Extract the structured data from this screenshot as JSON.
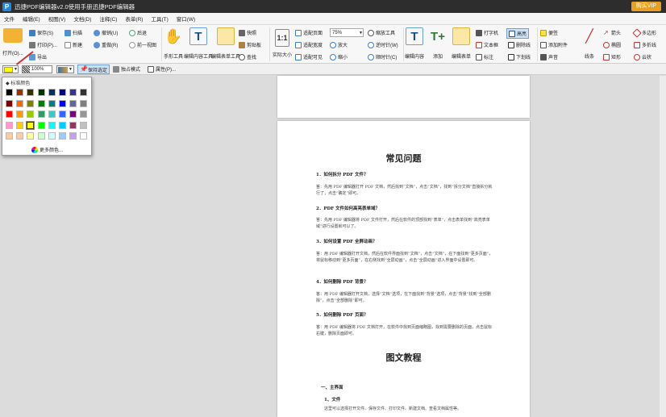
{
  "title": "迅捷PDF编辑器v2.0使用手册迅捷PDF编辑器",
  "vip_button": "购买VIP",
  "menu": [
    "文件",
    "编辑(E)",
    "视图(V)",
    "文档(D)",
    "注释(C)",
    "表单(R)",
    "工具(T)",
    "窗口(W)"
  ],
  "ribbon": {
    "open": "打开(O)...",
    "save": "保存(S)",
    "print": "打印(P)...",
    "export": "导出",
    "scan": "扫描",
    "new": "新建",
    "undo": "撤销(U)",
    "redo": "重做(R)",
    "prev_view": "后退",
    "next_view": "前一视图",
    "hand_tool": "手形工具",
    "edit_content_tool": "编辑内容工具",
    "edit_form_tool": "编辑表单工具",
    "snapshot": "快照",
    "clipboard": "剪贴板",
    "find": "查找",
    "actual_size": "实际大小",
    "fit_page": "适配页面",
    "fit_width": "适配宽度",
    "fit_visible": "适配可见",
    "zoom_value": "75%",
    "zoom_in": "放大",
    "zoom_out": "缩小",
    "zoom_tool": "缩放工具",
    "rotate_left": "逆时针(W)",
    "rotate_right": "顺时针(C)",
    "edit_content": "编辑内容",
    "add": "添加",
    "edit_form": "编辑表单",
    "typewriter": "打字机",
    "text_box": "文本框",
    "callout": "标注",
    "highlight": "高亮",
    "strikeout": "删除线",
    "underline": "下划线",
    "note": "便签",
    "attach_file": "添加附件",
    "sound": "声音",
    "line": "线条",
    "arrow": "箭头",
    "oval": "椭圆",
    "rectangle": "矩形",
    "polygon": "多边形",
    "polyline": "多折线",
    "cloud": "云状"
  },
  "toolbar2": {
    "opacity": "100%",
    "keep_tool_selected": "保持选定",
    "exclusive_mode": "独占模式",
    "properties": "属性(P)..."
  },
  "palette": {
    "header": "标准颜色",
    "more_colors": "更多颜色...",
    "selected": "#ffff00",
    "colors": [
      [
        "#000000",
        "#993300",
        "#333300",
        "#003300",
        "#003366",
        "#000080",
        "#333399",
        "#333333"
      ],
      [
        "#800000",
        "#ff6600",
        "#808000",
        "#008000",
        "#008080",
        "#0000ff",
        "#666699",
        "#808080"
      ],
      [
        "#ff0000",
        "#ff9900",
        "#99cc00",
        "#339966",
        "#33cccc",
        "#3366ff",
        "#800080",
        "#969696"
      ],
      [
        "#ff99cc",
        "#ffcc00",
        "#ffff00",
        "#00ff00",
        "#00ffff",
        "#00ccff",
        "#993366",
        "#c0c0c0"
      ],
      [
        "#ffcc99",
        "#ffcc99",
        "#ffff99",
        "#ccffcc",
        "#ccffff",
        "#99ccff",
        "#cc99ff",
        "#ffffff"
      ]
    ]
  },
  "document": {
    "heading1": "常见问题",
    "faq": [
      {
        "q": "1．如何拆分 PDF 文件？",
        "a": "答：先用 PDF 编辑器打开 PDF 文档，然后找到“文档”，点击“文档”，找到“拆分文档”直接拆分就行了，点击“确定”即可。"
      },
      {
        "q": "2．PDF 文件如何高亮表单域？",
        "a": "答：先用 PDF 编辑器将 PDF 文件打开，然后在软件的顶部找到“表单”，点击表单找到“高亮表单域”进行设置就可以了。"
      },
      {
        "q": "3．如何设置 PDF 全屏动画？",
        "a": "答：用 PDF 编辑器打开文档，然后在软件界面找到“文档”，点击“文档”，在下面找到“更多页面”，将鼠标移动到“更多页面”，在右侧找到“全屏动画”，点击“全屏动画”进入界面中设置即可。"
      },
      {
        "q": "4．如何删除 PDF 背景？",
        "a": "答：用 PDF 编辑器打开文档，选择“文档”选项，在下面找到“背景”选项，点击“背景”找到“全部删除”，点击“全部删除”即可。"
      },
      {
        "q": "5．如何删除 PDF 页面？",
        "a": "答：用 PDF 编辑器将 PDF 文档打开，在软件中找到页面缩略图，找到需要删除的页面，点击鼠标右键，删除页面即可。"
      }
    ],
    "heading2": "图文教程",
    "section1": "一、主界面",
    "section1_1": "1、文件",
    "section1_1_text": "这里可以选择打开文件、保存文件、打印文件、新建文档、查看文档属性等。"
  }
}
